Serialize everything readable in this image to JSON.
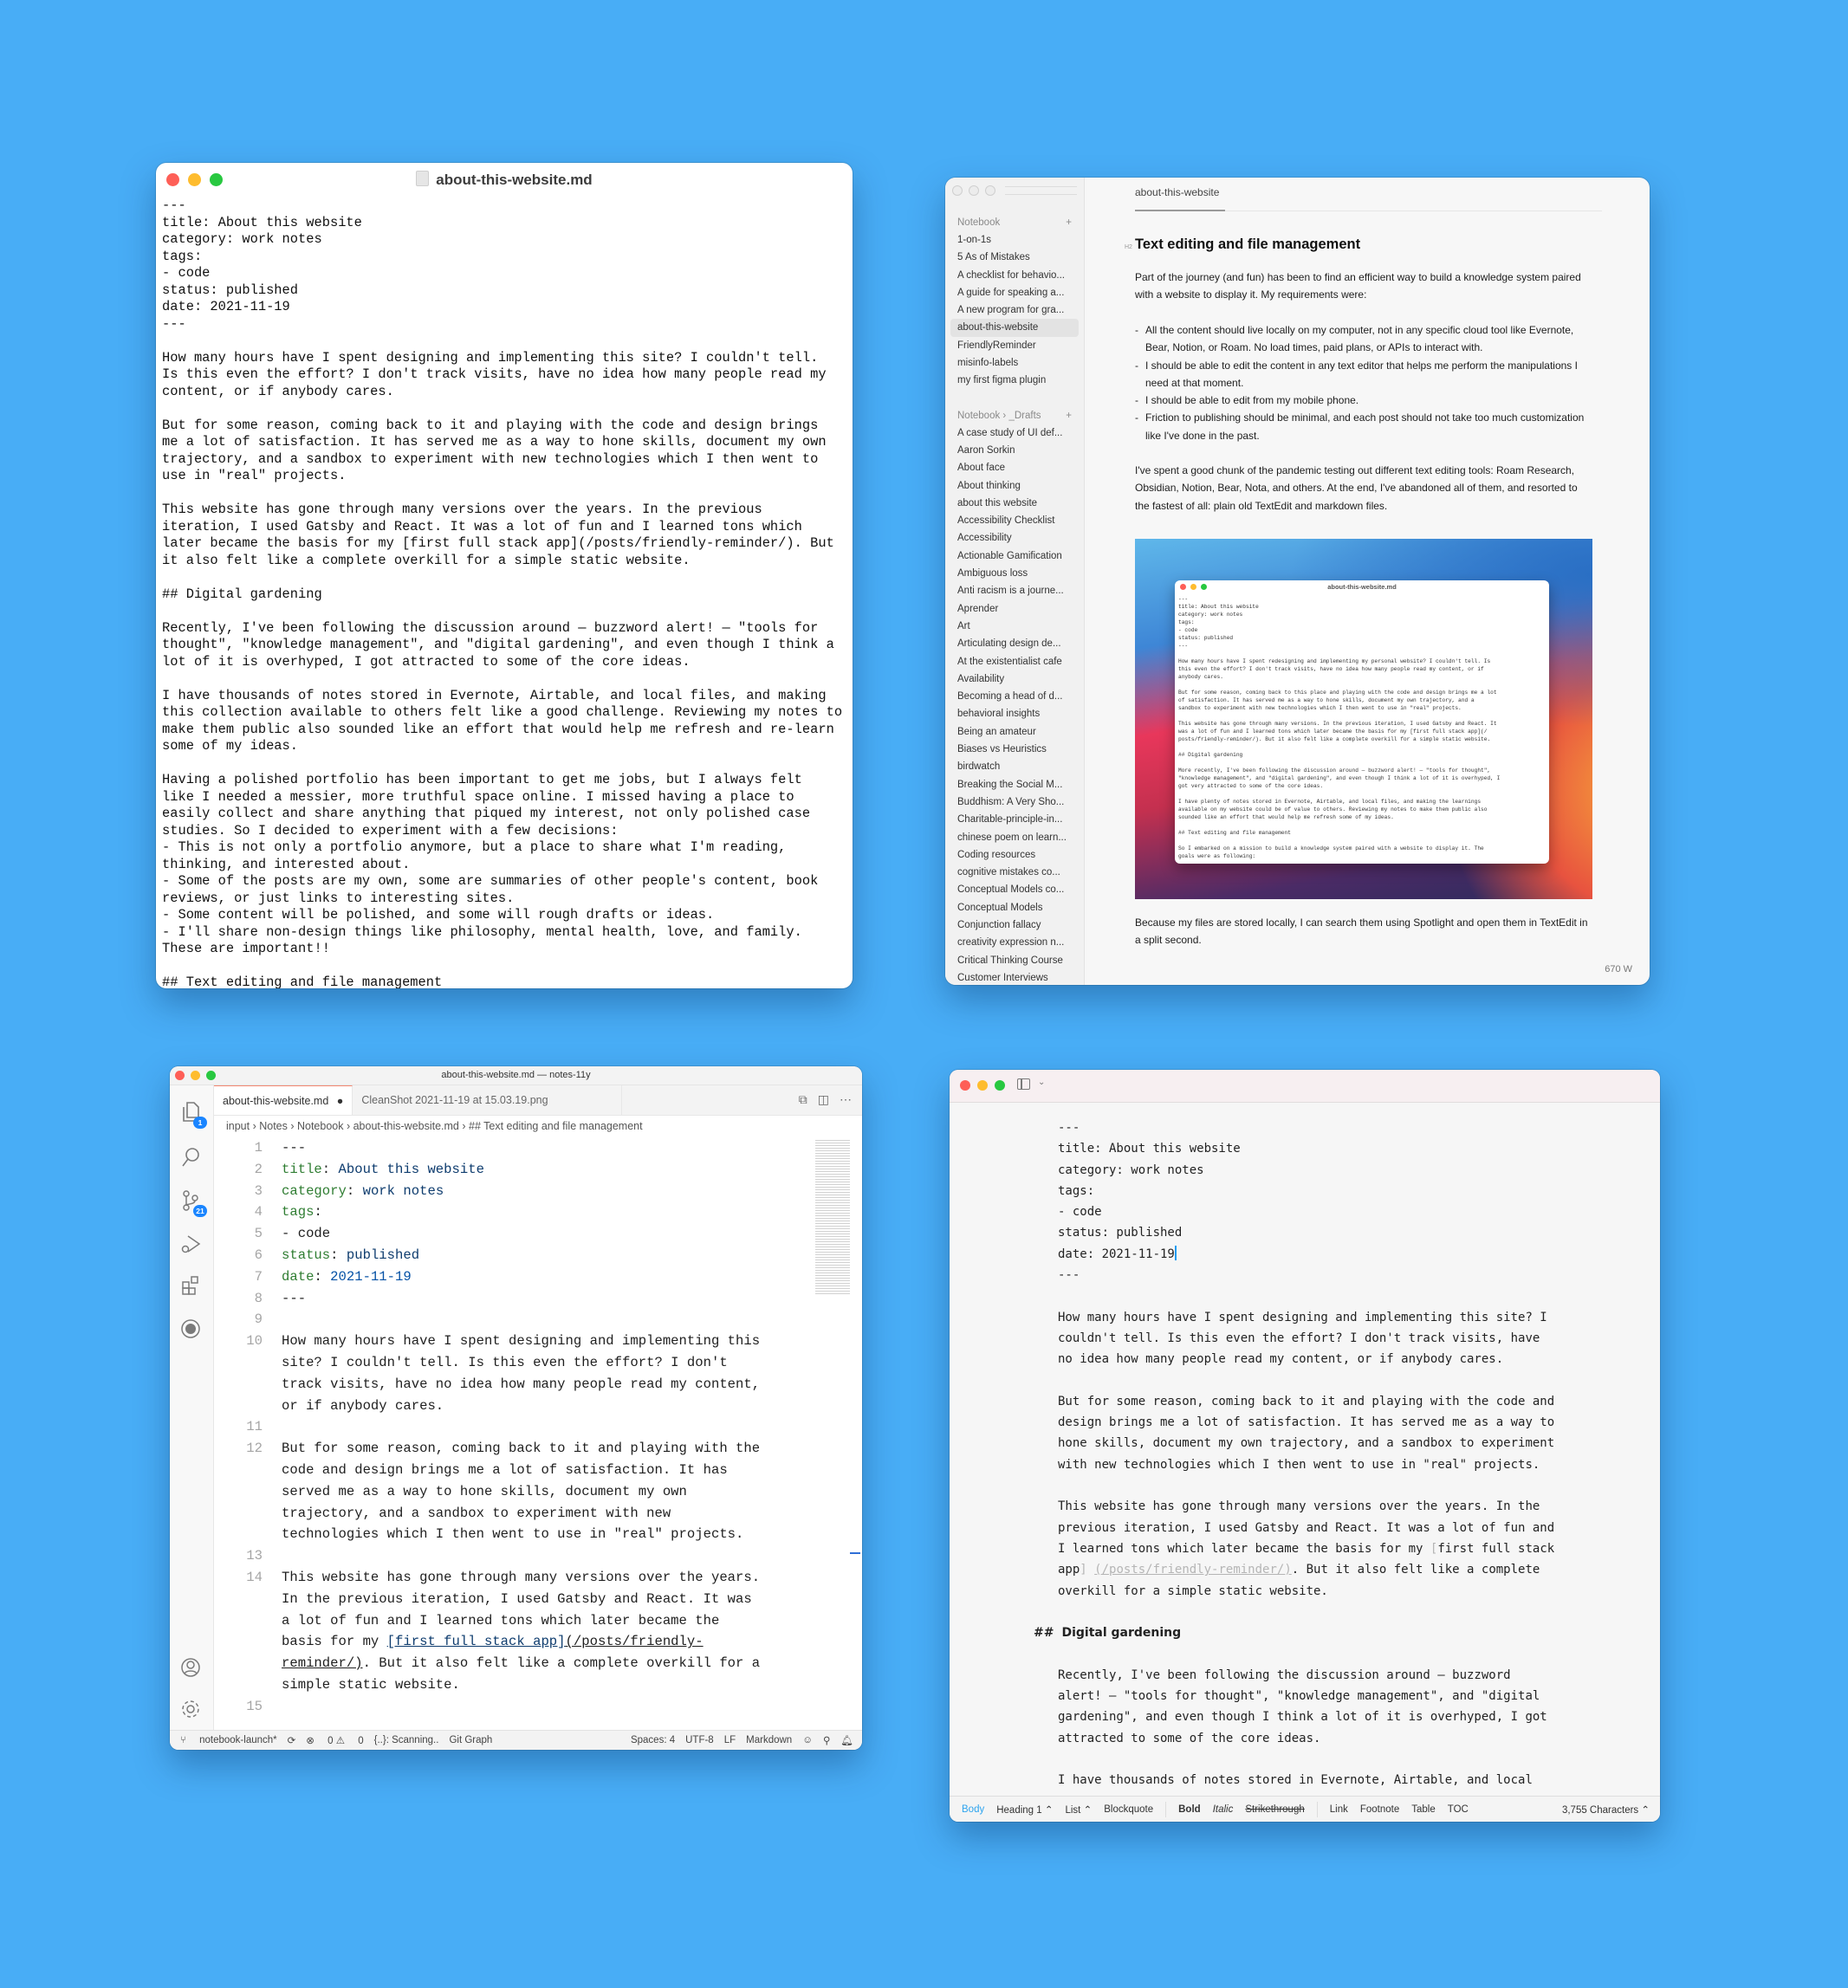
{
  "background_color": "#48adf6",
  "textedit": {
    "title": "about-this-website.md",
    "lines": [
      "---",
      "title: About this website",
      "category: work notes",
      "tags:",
      "- code",
      "status: published",
      "date: 2021-11-19",
      "---",
      "",
      "How many hours have I spent designing and implementing this site? I couldn't tell.",
      "Is this even the effort? I don't track visits, have no idea how many people read my",
      "content, or if anybody cares.",
      "",
      "But for some reason, coming back to it and playing with the code and design brings",
      "me a lot of satisfaction. It has served me as a way to hone skills, document my own",
      "trajectory, and a sandbox to experiment with new technologies which I then went to",
      "use in \"real\" projects.",
      "",
      "This website has gone through many versions over the years. In the previous",
      "iteration, I used Gatsby and React. It was a lot of fun and I learned tons which",
      "later became the basis for my [first full stack app](/posts/friendly-reminder/). But",
      "it also felt like a complete overkill for a simple static website.",
      "",
      "## Digital gardening",
      "",
      "Recently, I've been following the discussion around — buzzword alert! — \"tools for",
      "thought\", \"knowledge management\", and \"digital gardening\", and even though I think a",
      "lot of it is overhyped, I got attracted to some of the core ideas.",
      "",
      "I have thousands of notes stored in Evernote, Airtable, and local files, and making",
      "this collection available to others felt like a good challenge. Reviewing my notes to",
      "make them public also sounded like an effort that would help me refresh and re-learn",
      "some of my ideas.",
      "",
      "Having a polished portfolio has been important to get me jobs, but I always felt",
      "like I needed a messier, more truthful space online. I missed having a place to",
      "easily collect and share anything that piqued my interest, not only polished case",
      "studies. So I decided to experiment with a few decisions:",
      "- This is not only a portfolio anymore, but a place to share what I'm reading,",
      "thinking, and interested about.",
      "- Some of the posts are my own, some are summaries of other people's content, book",
      "reviews, or just links to interesting sites.",
      "- Some content will be polished, and some will rough drafts or ideas.",
      "- I'll share non-design things like philosophy, mental health, love, and family.",
      "These are important!!",
      "",
      "## Text editing and file management"
    ]
  },
  "notes_app": {
    "sidebar": {
      "section1": {
        "title": "Notebook",
        "add": "+"
      },
      "items1": [
        "1-on-1s",
        "5 As of Mistakes",
        "A checklist for behavio...",
        "A guide for speaking a...",
        "A new program for gra...",
        "about-this-website",
        "FriendlyReminder",
        "misinfo-labels",
        "my first figma plugin"
      ],
      "active_item": "about-this-website",
      "section2": {
        "title": "Notebook › _Drafts",
        "add": "+"
      },
      "items2": [
        "A case study of UI def...",
        "Aaron Sorkin",
        "About face",
        "About thinking",
        "about this website",
        "Accessibility Checklist",
        "Accessibility",
        "Actionable Gamification",
        "Ambiguous loss",
        "Anti racism is a journe...",
        "Aprender",
        "Art",
        "Articulating design de...",
        "At the existentialist cafe",
        "Availability",
        "Becoming a head of d...",
        "behavioral insights",
        "Being an amateur",
        "Biases vs Heuristics",
        "birdwatch",
        "Breaking the Social M...",
        "Buddhism: A Very Sho...",
        "Charitable-principle-in...",
        "chinese poem on learn...",
        "Coding resources",
        "cognitive mistakes co...",
        "Conceptual Models co...",
        "Conceptual Models",
        "Conjunction fallacy",
        "creativity expression n...",
        "Critical Thinking Course",
        "Customer Interviews"
      ]
    },
    "doc_tab": "about-this-website",
    "heading_tag": "H2",
    "heading": "Text editing and file management",
    "intro": "Part of the journey (and fun) has been to find an efficient way to build a knowledge system paired with a website to display it. My requirements were:",
    "requirements": [
      "All the content should live locally on my computer, not in any specific cloud tool like Evernote, Bear, Notion, or Roam. No load times, paid plans, or APIs to interact with.",
      "I should be able to edit the content in any text editor that helps me perform the manipulations I need at that moment.",
      "I should be able to edit from my mobile phone.",
      "Friction to publishing should be minimal, and each post should not take too much customization like I've done in the past."
    ],
    "tools_paragraph": "I've spent a good chunk of the pandemic testing out different text editing tools: Roam Research, Obsidian, Notion, Bear, Nota, and others. At the end, I've abandoned all of them, and resorted to the fastest of all: plain old TextEdit and markdown files.",
    "embedded_screenshot": {
      "title": "about-this-website.md",
      "text": "---\ntitle: About this website\ncategory: work notes\ntags:\n- code\nstatus: published\n---\n\nHow many hours have I spent redesigning and implementing my personal website? I couldn't tell. Is\nthis even the effort? I don't track visits, have no idea how many people read my content, or if\nanybody cares.\n\nBut for some reason, coming back to this place and playing with the code and design brings me a lot\nof satisfaction. It has served me as a way to hone skills, document my own trajectory, and a\nsandbox to experiment with new technologies which I then went to use in \"real\" projects.\n\nThis website has gone through many versions. In the previous iteration, I used Gatsby and React. It\nwas a lot of fun and I learned tons which later became the basis for my [first full stack app](/\nposts/friendly-reminder/). But it also felt like a complete overkill for a simple static website.\n\n## Digital gardening\n\nMore recently, I've been following the discussion around — buzzword alert! — \"tools for thought\",\n\"knowledge management\", and \"digital gardening\", and even though I think a lot of it is overhyped, I\ngot very attracted to some of the core ideas.\n\nI have plenty of notes stored in Evernote, Airtable, and local files, and making the learnings\navailable on my website could be of value to others. Reviewing my notes to make them public also\nsounded like an effort that would help me refresh some of my ideas.\n\n## Text editing and file management\n\nSo I embarked on a mission to build a knowledge system paired with a website to display it. The\ngoals were as following:"
    },
    "after_paragraph": "Because my files are stored locally, I can search them using Spotlight and open them in TextEdit in a split second.",
    "word_count": "670 W"
  },
  "vscode": {
    "window_title": "about-this-website.md — notes-11y",
    "activity_badges": {
      "explorer": "1",
      "source_control": "21"
    },
    "tabs": [
      {
        "label": "about-this-website.md",
        "modified_dot": "●",
        "active": true
      },
      {
        "label": "CleanShot 2021-11-19 at 15.03.19.png",
        "active": false
      }
    ],
    "breadcrumb": [
      "input",
      "Notes",
      "Notebook",
      "about-this-website.md",
      "## Text editing and file management"
    ],
    "breadcrumb_sep": "›",
    "lines": [
      {
        "n": "1",
        "text": "---"
      },
      {
        "n": "2",
        "key": "title",
        "val": "About this website"
      },
      {
        "n": "3",
        "key": "category",
        "val": "work notes"
      },
      {
        "n": "4",
        "key": "tags",
        "val": ""
      },
      {
        "n": "5",
        "text": "- code"
      },
      {
        "n": "6",
        "key": "status",
        "val": "published"
      },
      {
        "n": "7",
        "key": "date",
        "val": "2021-11-19"
      },
      {
        "n": "8",
        "text": "---"
      },
      {
        "n": "9",
        "text": ""
      },
      {
        "n": "10",
        "text": "How many hours have I spent designing and implementing this site? I couldn't tell. Is this even the effort? I don't track visits, have no idea how many people read my content, or if anybody cares."
      },
      {
        "n": "11",
        "text": ""
      },
      {
        "n": "12",
        "text": "But for some reason, coming back to it and playing with the code and design brings me a lot of satisfaction. It has served me as a way to hone skills, document my own trajectory, and a sandbox to experiment with new technologies which I then went to use in \"real\" projects."
      },
      {
        "n": "13",
        "text": ""
      },
      {
        "n": "14",
        "pre": "This website has gone through many versions over the years. In the previous iteration, I used Gatsby and React. It was a lot of fun and I learned tons which later became the basis for my ",
        "link_text": "[first full stack app]",
        "link_url": "(/posts/friendly-reminder/)",
        "post": ". But it also felt like a complete overkill for a simple static website."
      },
      {
        "n": "15",
        "text": ""
      }
    ],
    "status": {
      "branch": "notebook-launch*",
      "errors": "0",
      "warnings": "0",
      "scanning": "{..}: Scanning..",
      "git_graph": "Git Graph",
      "spaces": "Spaces: 4",
      "encoding": "UTF-8",
      "eol": "LF",
      "language": "Markdown"
    }
  },
  "bear": {
    "front_matter": [
      "---",
      "title: About this website",
      "category: work notes",
      "tags:",
      "- code",
      "status: published",
      "date: 2021-11-19",
      "---"
    ],
    "p1": "How many hours have I spent designing and implementing this site? I couldn't tell. Is this even the effort? I don't track visits, have no idea how many people read my content, or if anybody cares.",
    "p2": "But for some reason, coming back to it and playing with the code and design brings me a lot of satisfaction. It has served me as a way to hone skills, document my own trajectory, and a sandbox to experiment with new technologies which I then went to use in \"real\" projects.",
    "p3_pre": "This website has gone through many versions over the years. In the previous iteration, I used Gatsby and React. It was a lot of fun and I learned tons which later became the basis for my ",
    "p3_bracket_open": "[",
    "p3_link": "first full stack app",
    "p3_bracket_close": "]",
    "p3_url": "(/posts/friendly-reminder/)",
    "p3_post": ". But it also felt like a complete overkill for a simple static website.",
    "h2_hash": "##",
    "h2": "Digital gardening",
    "p4": "Recently, I've been following the discussion around — buzzword alert! — \"tools for thought\", \"knowledge management\", and \"digital gardening\", and even though I think a lot of it is overhyped, I got attracted to some of the core ideas.",
    "p5": "I have thousands of notes stored in Evernote, Airtable, and local files,",
    "format_bar": {
      "body": "Body",
      "heading": "Heading 1 ⌃",
      "list": "List ⌃",
      "blockquote": "Blockquote",
      "bold": "Bold",
      "italic": "Italic",
      "strike": "Strikethrough",
      "link": "Link",
      "footnote": "Footnote",
      "table": "Table",
      "toc": "TOC",
      "count": "3,755 Characters ⌃"
    }
  }
}
